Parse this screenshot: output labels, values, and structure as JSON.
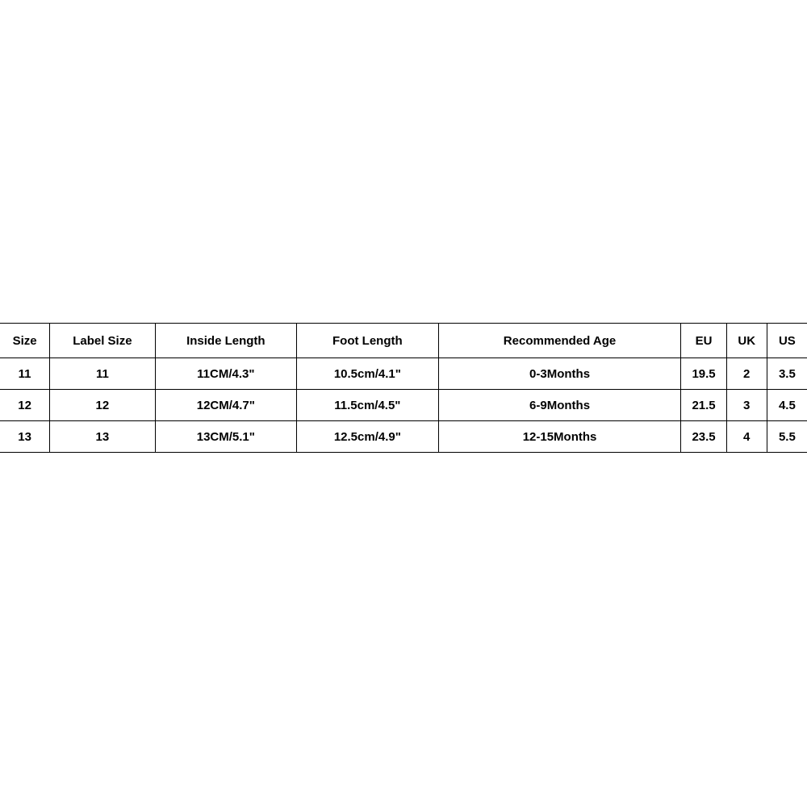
{
  "chart_data": {
    "type": "table",
    "headers": [
      "Size",
      "Label Size",
      "Inside Length",
      "Foot Length",
      "Recommended Age",
      "EU",
      "UK",
      "US"
    ],
    "rows": [
      [
        "11",
        "11",
        "11CM/4.3\"",
        "10.5cm/4.1\"",
        "0-3Months",
        "19.5",
        "2",
        "3.5"
      ],
      [
        "12",
        "12",
        "12CM/4.7\"",
        "11.5cm/4.5\"",
        "6-9Months",
        "21.5",
        "3",
        "4.5"
      ],
      [
        "13",
        "13",
        "13CM/5.1\"",
        "12.5cm/4.9\"",
        "12-15Months",
        "23.5",
        "4",
        "5.5"
      ]
    ]
  }
}
